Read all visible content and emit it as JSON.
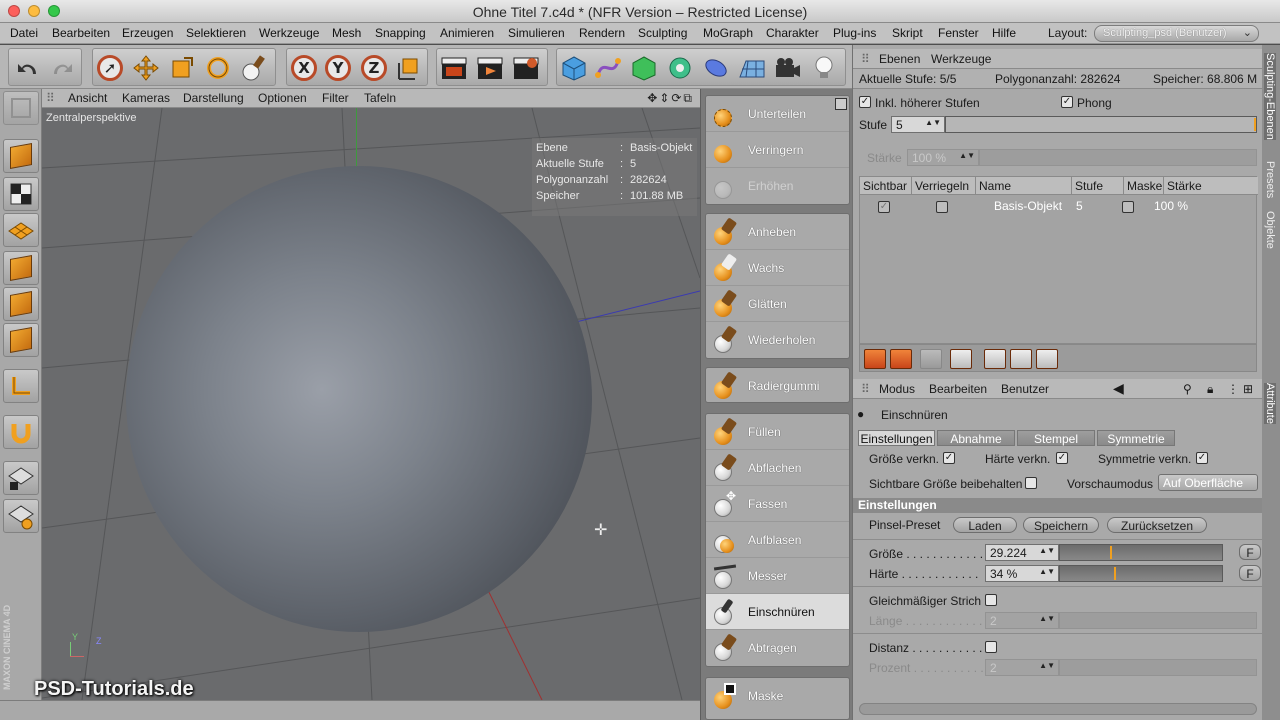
{
  "window": {
    "title": "Ohne Titel 7.c4d * (NFR Version – Restricted License)"
  },
  "menu": {
    "items": [
      "Datei",
      "Bearbeiten",
      "Erzeugen",
      "Selektieren",
      "Werkzeuge",
      "Mesh",
      "Snapping",
      "Animieren",
      "Simulieren",
      "Rendern",
      "Sculpting",
      "MoGraph",
      "Charakter",
      "Plug-ins",
      "Skript",
      "Fenster",
      "Hilfe"
    ],
    "layout_label": "Layout:",
    "layout_value": "Sculpting_psd (Benutzer)"
  },
  "toolbar": {
    "axis_x": "X",
    "axis_y": "Y",
    "axis_z": "Z"
  },
  "viewport": {
    "menu": [
      "Ansicht",
      "Kameras",
      "Darstellung",
      "Optionen",
      "Filter",
      "Tafeln"
    ],
    "nav_icons": "✥⇕⟳⧉",
    "camera_label": "Zentralperspektive",
    "info": [
      {
        "key": "Ebene",
        "val": "Basis-Objekt"
      },
      {
        "key": "Aktuelle Stufe",
        "val": "5"
      },
      {
        "key": "Polygonanzahl",
        "val": "282624"
      },
      {
        "key": "Speicher",
        "val": "101.88 MB"
      }
    ],
    "watermark": "PSD-Tutorials.de",
    "brand": "MAXON CINEMA 4D",
    "axis_y": "Y",
    "axis_z": "Z"
  },
  "sculpt_tools": {
    "group1": [
      "Unterteilen",
      "Verringern",
      "Erhöhen"
    ],
    "group2": [
      "Anheben",
      "Wachs",
      "Glätten",
      "Wiederholen"
    ],
    "group3": [
      "Radiergummi"
    ],
    "group4": [
      "Füllen",
      "Abflachen",
      "Fassen",
      "Aufblasen",
      "Messer",
      "Einschnüren",
      "Abtragen"
    ],
    "group5": [
      "Maske"
    ],
    "active": "Einschnüren"
  },
  "layers_panel": {
    "tabs": [
      "Ebenen",
      "Werkzeuge"
    ],
    "current_level_label": "Aktuelle Stufe: 5/5",
    "polycount_label": "Polygonanzahl: 282624",
    "memory_label": "Speicher: 68.806 M",
    "incl_higher": "Inkl. höherer Stufen",
    "phong": "Phong",
    "stufe_label": "Stufe",
    "stufe_value": "5",
    "staerke_label": "Stärke",
    "staerke_value": "100 %",
    "columns": [
      "Sichtbar",
      "Verriegeln",
      "Name",
      "Stufe",
      "Maske",
      "Stärke"
    ],
    "row": {
      "name": "Basis-Objekt",
      "stufe": "5",
      "staerke": "100 %"
    }
  },
  "attributes": {
    "menu": [
      "Modus",
      "Bearbeiten",
      "Benutzer"
    ],
    "tool_name": "Einschnüren",
    "tabs": [
      "Einstellungen",
      "Abnahme",
      "Stempel",
      "Symmetrie"
    ],
    "groesse_verkn": "Größe verkn.",
    "haerte_verkn": "Härte verkn.",
    "symmetrie_verkn": "Symmetrie verkn.",
    "sichtbare_groesse": "Sichtbare Größe beibehalten",
    "vorschaumodus": "Vorschaumodus",
    "vorschau_value": "Auf Oberfläche",
    "section": "Einstellungen",
    "pinsel_preset": "Pinsel-Preset",
    "btn_laden": "Laden",
    "btn_speichern": "Speichern",
    "btn_zuruecksetzen": "Zurücksetzen",
    "groesse_label": "Größe . . . . . . . . . . . .",
    "groesse_value": "29.224",
    "groesse_fraction": 0.31,
    "haerte_label": "Härte . . . . . . . . . . . .",
    "haerte_value": "34 %",
    "haerte_fraction": 0.34,
    "gleichmaessig": "Gleichmäßiger Strich",
    "laenge_label": "Länge . . . . . . . . . . . .",
    "laenge_value": "2",
    "distanz": "Distanz . . . . . . . . . . .",
    "prozent_label": "Prozent . . . . . . . . . . .",
    "prozent_value": "2",
    "f_btn": "F"
  },
  "right_tabs": [
    "Sculpting-Ebenen",
    "Presets",
    "Objekte",
    "Attribute"
  ]
}
